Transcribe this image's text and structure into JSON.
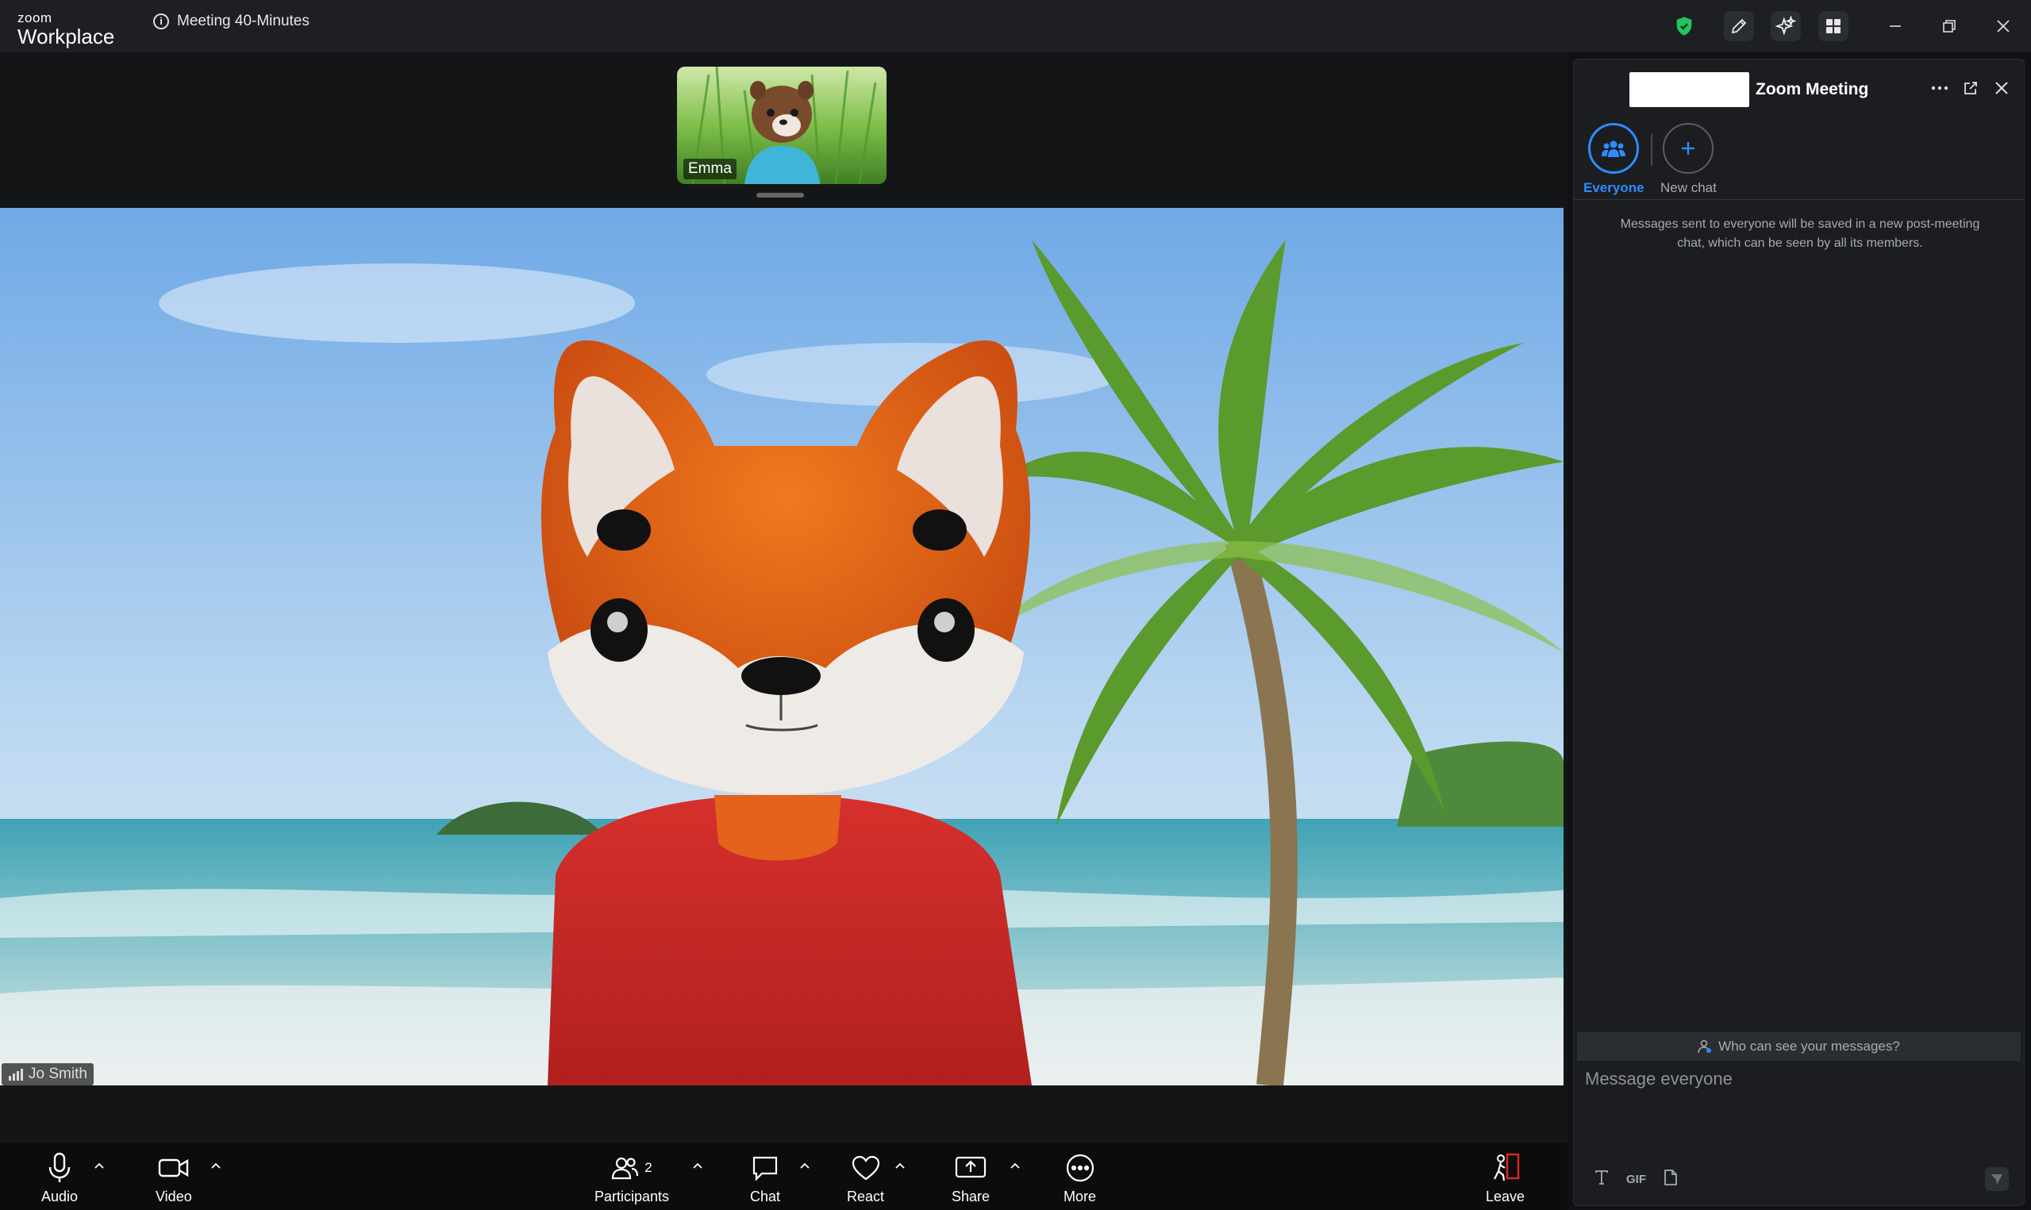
{
  "app": {
    "brand_small": "zoom",
    "brand_big": "Workplace",
    "meeting_title": "Meeting 40-Minutes"
  },
  "colors": {
    "accent": "#2d8cff",
    "secure": "#22c55e",
    "leave": "#e02828"
  },
  "thumbnail": {
    "name": "Emma"
  },
  "main_video": {
    "name": "Jo Smith"
  },
  "toolbar": {
    "audio": "Audio",
    "video": "Video",
    "participants": "Participants",
    "participants_count": "2",
    "chat": "Chat",
    "react": "React",
    "share": "Share",
    "more": "More",
    "leave": "Leave"
  },
  "chat_panel": {
    "title": "Zoom Meeting",
    "tabs": [
      {
        "label": "Everyone"
      },
      {
        "label": "New chat"
      }
    ],
    "notice": "Messages sent to everyone will be saved in a new post-meeting chat, which can be seen by all its members.",
    "who_can_see": "Who can see your messages?",
    "input_placeholder": "Message everyone",
    "gif_label": "GIF"
  }
}
